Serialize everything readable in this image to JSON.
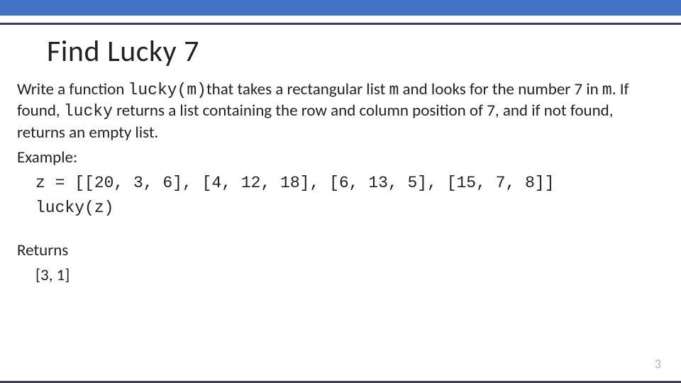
{
  "title": "Find Lucky 7",
  "para": {
    "t1": "Write a function ",
    "code1": "lucky(m)",
    "t2": "that takes a rectangular list ",
    "code2": "m",
    "t3": " and looks for the number 7 in  ",
    "code3": "m",
    "t4": ". If found, ",
    "code4": "lucky",
    "t5": " returns a list containing the row and column position of 7, and if not found, returns an empty list."
  },
  "example_label": "Example:",
  "example_assign": "z = [[20, 3, 6], [4, 12, 18], [6, 13, 5], [15, 7, 8]]",
  "example_call": "lucky(z)",
  "returns_label": "Returns",
  "returns_value": "[3, 1]",
  "page_number": "3"
}
